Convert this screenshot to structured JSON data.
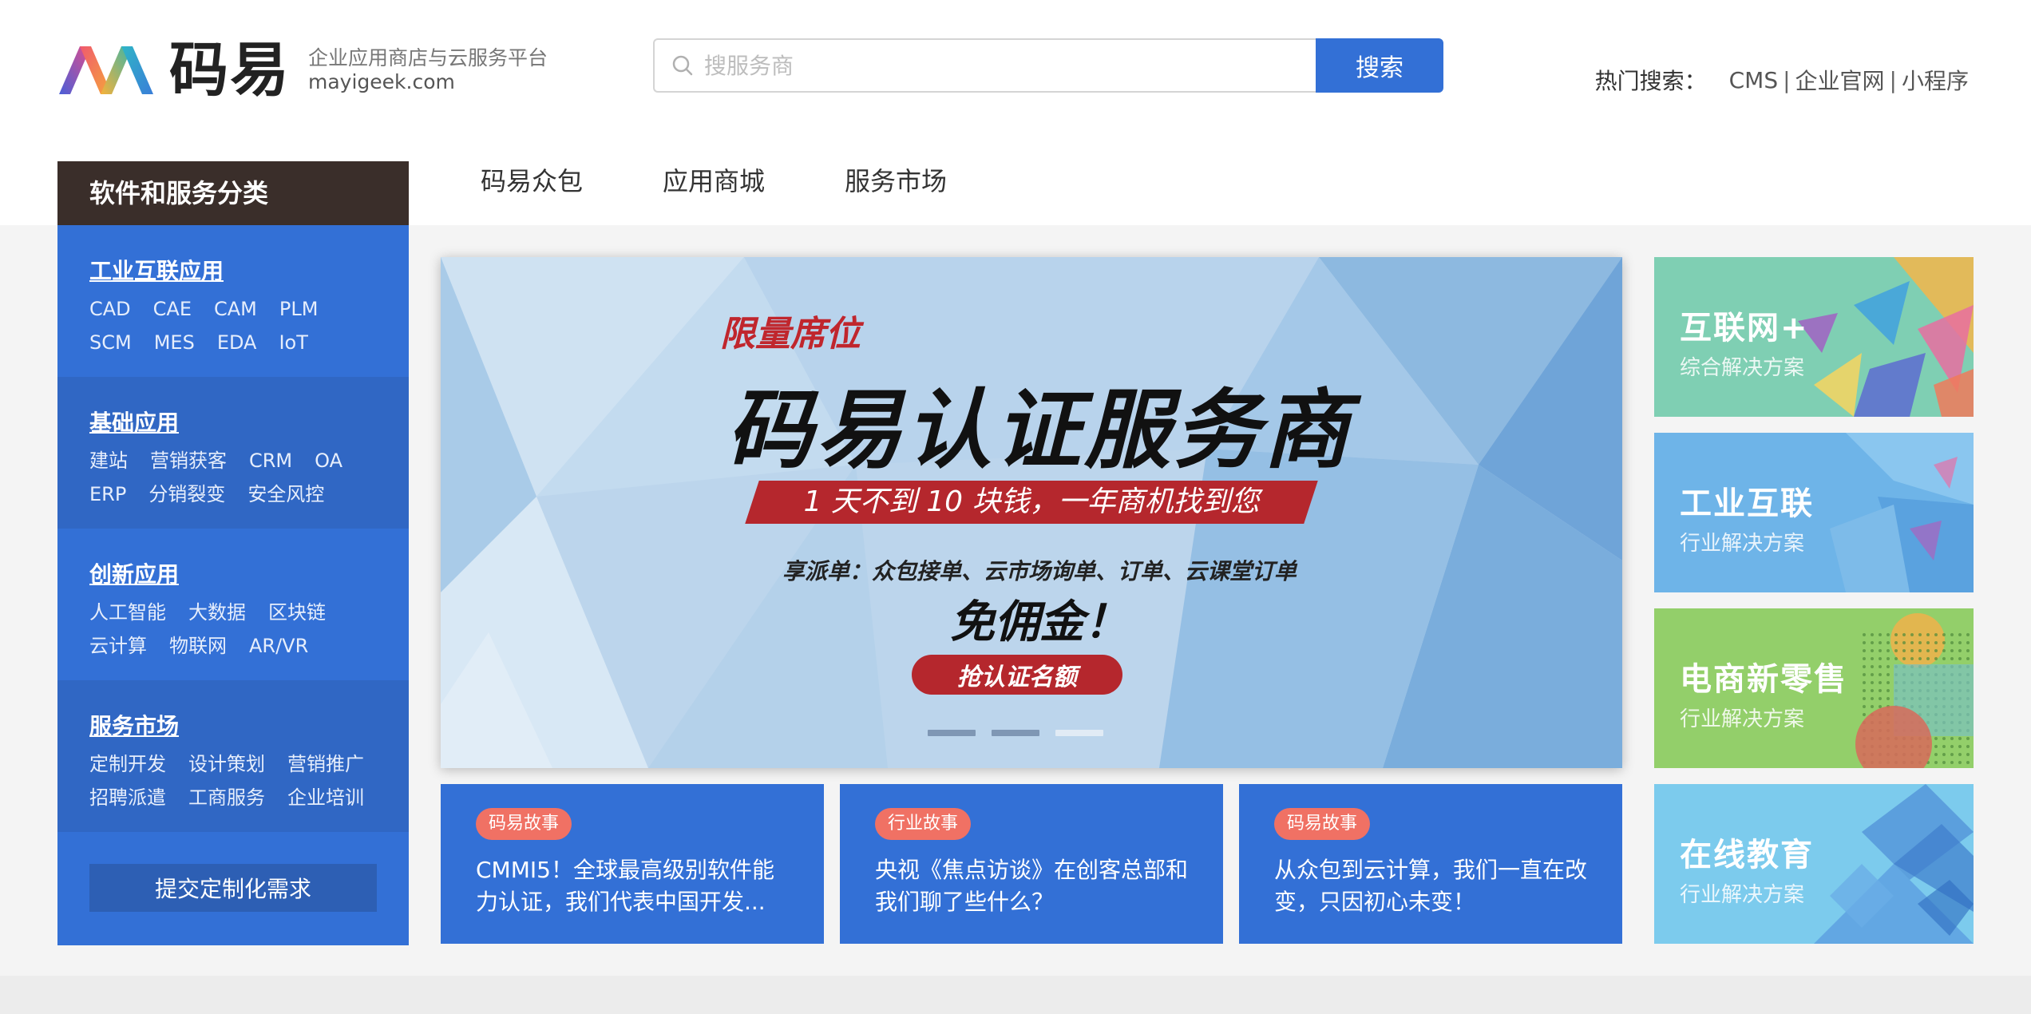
{
  "logo": {
    "name": "码易",
    "slogan": "企业应用商店与云服务平台",
    "domain": "mayigeek.com"
  },
  "search": {
    "placeholder": "搜服务商",
    "button_label": "搜索"
  },
  "hot_search": {
    "label": "热门搜索：",
    "items": [
      "CMS",
      "企业官网",
      "小程序"
    ],
    "separator": "|"
  },
  "nav": {
    "items": [
      "码易众包",
      "应用商城",
      "服务市场"
    ]
  },
  "sidebar": {
    "header": "软件和服务分类",
    "sections": [
      {
        "title": "工业互联应用",
        "rows": [
          [
            "CAD",
            "CAE",
            "CAM",
            "PLM"
          ],
          [
            "SCM",
            "MES",
            "EDA",
            "IoT"
          ]
        ]
      },
      {
        "title": "基础应用",
        "rows": [
          [
            "建站",
            "营销获客",
            "CRM",
            "OA"
          ],
          [
            "ERP",
            "分销裂变",
            "安全风控"
          ]
        ]
      },
      {
        "title": "创新应用",
        "rows": [
          [
            "人工智能",
            "大数据",
            "区块链"
          ],
          [
            "云计算",
            "物联网",
            "AR/VR"
          ]
        ]
      },
      {
        "title": "服务市场",
        "rows": [
          [
            "定制开发",
            "设计策划",
            "营销推广"
          ],
          [
            "招聘派遣",
            "工商服务",
            "企业培训"
          ]
        ]
      }
    ],
    "submit_label": "提交定制化需求"
  },
  "banner": {
    "tag": "限量席位",
    "title": "码易认证服务商",
    "ribbon": "1 天不到 10 块钱，一年商机找到您",
    "subtitle": "享派单：众包接单、云市场询单、订单、云课堂订单",
    "free": "免佣金！",
    "cta": "抢认证名额",
    "slides_count": 3,
    "active_slide": 3
  },
  "stories": [
    {
      "tag": "码易故事",
      "text": "CMMI5！全球最高级别软件能力认证，我们代表中国开发..."
    },
    {
      "tag": "行业故事",
      "text": "央视《焦点访谈》在创客总部和我们聊了些什么？"
    },
    {
      "tag": "码易故事",
      "text": "从众包到云计算，我们一直在改变，只因初心未变！"
    }
  ],
  "solutions": [
    {
      "title": "互联网+",
      "subtitle": "综合解决方案",
      "color": "#7fcfb3"
    },
    {
      "title": "工业互联",
      "subtitle": "行业解决方案",
      "color": "#6eb4e8"
    },
    {
      "title": "电商新零售",
      "subtitle": "行业解决方案",
      "color": "#93cf6a"
    },
    {
      "title": "在线教育",
      "subtitle": "行业解决方案",
      "color": "#7ccbed"
    }
  ],
  "colors": {
    "primary": "#3370d6",
    "sidebar_header": "#3a2e2a",
    "tag": "#f07164",
    "banner_red": "#b5272d"
  }
}
